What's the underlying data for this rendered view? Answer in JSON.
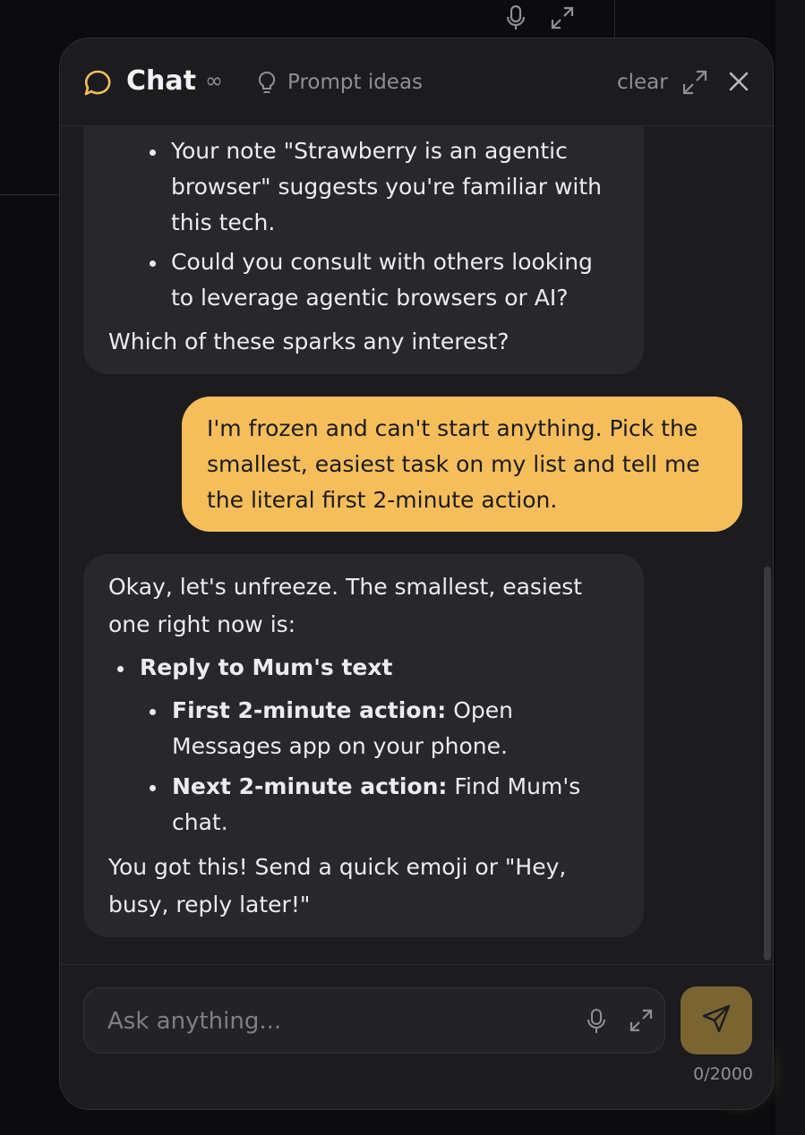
{
  "header": {
    "title": "Chat",
    "infinity": "∞",
    "prompt_ideas": "Prompt ideas",
    "clear": "clear"
  },
  "messages": {
    "ai_1": {
      "bullet_1_line_1": "Your note \"Strawberry is an agentic",
      "bullet_1_line_2": "browser\" suggests you're familiar with",
      "bullet_1_line_3": "this tech.",
      "bullet_2_line_1": "Could you consult with others looking",
      "bullet_2_line_2": "to leverage agentic browsers or AI?",
      "closing": "Which of these sparks any interest?"
    },
    "user_1": {
      "line_1": "I'm frozen and can't start anything. Pick the",
      "line_2": "smallest, easiest task on my list and tell me",
      "line_3": "the literal first 2-minute action."
    },
    "ai_2": {
      "intro_line_1": "Okay, let's unfreeze. The smallest, easiest",
      "intro_line_2": "one right now is:",
      "task": "Reply to Mum's text",
      "step_1_label": "First 2-minute action:",
      "step_1_text_a": " Open",
      "step_1_text_b": "Messages app on your phone.",
      "step_2_label": "Next 2-minute action:",
      "step_2_text_a": " Find Mum's",
      "step_2_text_b": "chat.",
      "outro_line_1": "You got this! Send a quick emoji or \"Hey,",
      "outro_line_2": "busy, reply later!\""
    }
  },
  "composer": {
    "placeholder": "Ask anything...",
    "value": "",
    "counter": "0/2000"
  },
  "colors": {
    "accent": "#f5be5b",
    "send_button": "#7a6431",
    "panel_bg": "#1c1c1f",
    "ai_bubble": "#28282c"
  },
  "icons": [
    "chat-bubble-icon",
    "lightbulb-icon",
    "expand-icon",
    "close-icon",
    "microphone-icon",
    "send-icon"
  ]
}
